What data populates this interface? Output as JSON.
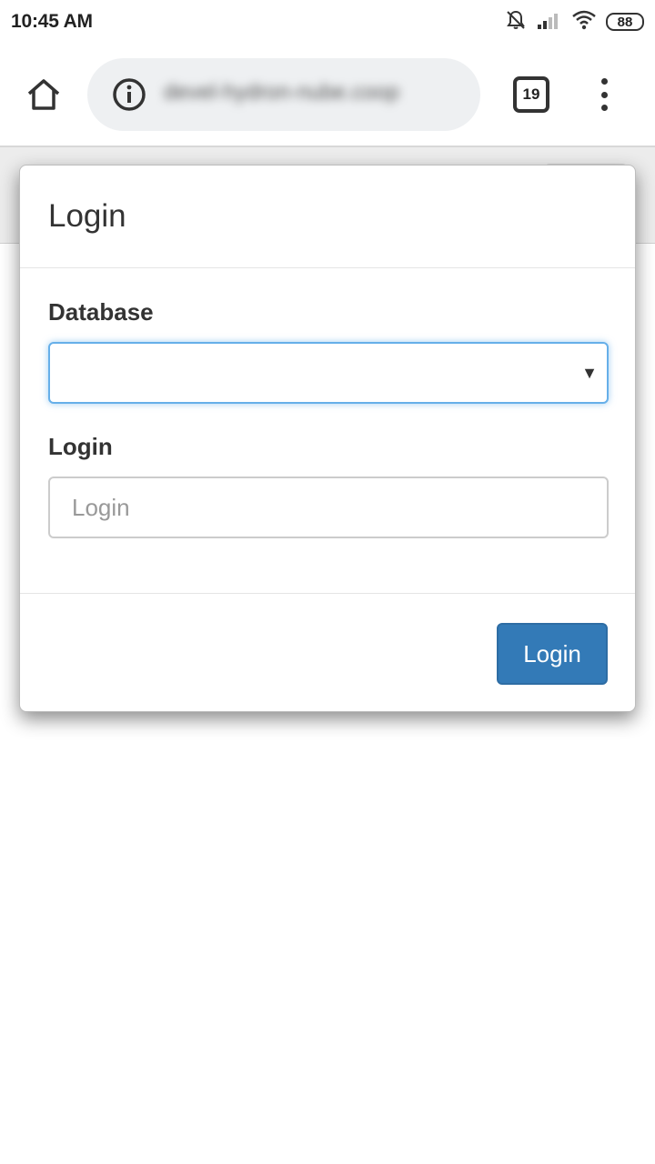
{
  "status_bar": {
    "time": "10:45 AM",
    "battery": "88",
    "icons": [
      "bell-muted-icon",
      "signal-icon",
      "wifi-icon",
      "battery-icon"
    ]
  },
  "browser": {
    "url": "devel-hydron-nube.coop",
    "tab_count": "19",
    "icons": [
      "home-icon",
      "info-icon",
      "tabs-icon",
      "menu-icon"
    ]
  },
  "modal": {
    "title": "Login",
    "database_label": "Database",
    "database_value": "",
    "login_label": "Login",
    "login_placeholder": "Login",
    "login_value": "",
    "submit_label": "Login",
    "colors": {
      "primary": "#337ab7",
      "focus": "#66afe9"
    }
  }
}
